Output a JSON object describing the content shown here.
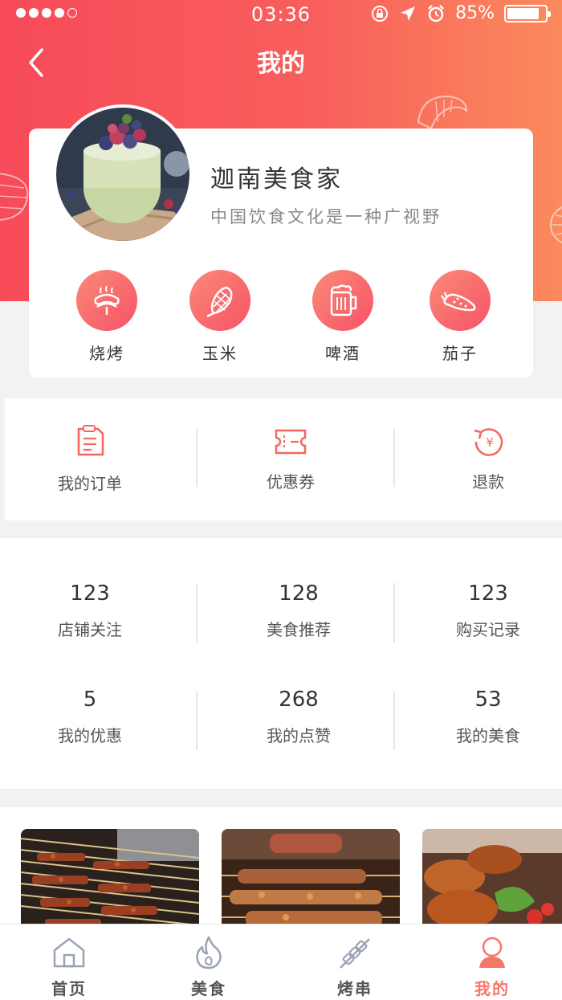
{
  "status_bar": {
    "time": "03:36",
    "battery": "85%",
    "battery_level": 0.85
  },
  "nav": {
    "title": "我的"
  },
  "profile": {
    "name": "迦南美食家",
    "description": "中国饮食文化是一种广视野"
  },
  "categories": [
    {
      "label": "烧烤",
      "icon": "sausage-icon"
    },
    {
      "label": "玉米",
      "icon": "corn-icon"
    },
    {
      "label": "啤酒",
      "icon": "beer-icon"
    },
    {
      "label": "茄子",
      "icon": "eggplant-icon"
    }
  ],
  "orders": [
    {
      "label": "我的订单",
      "icon": "order-list-icon"
    },
    {
      "label": "优惠券",
      "icon": "coupon-icon"
    },
    {
      "label": "退款",
      "icon": "refund-icon"
    }
  ],
  "stats": [
    {
      "value": "123",
      "label": "店铺关注"
    },
    {
      "value": "128",
      "label": "美食推荐"
    },
    {
      "value": "123",
      "label": "购买记录"
    },
    {
      "value": "5",
      "label": "我的优惠"
    },
    {
      "value": "268",
      "label": "我的点赞"
    },
    {
      "value": "53",
      "label": "我的美食"
    }
  ],
  "tabs": [
    {
      "label": "首页",
      "icon": "home-icon"
    },
    {
      "label": "美食",
      "icon": "flame-icon"
    },
    {
      "label": "烤串",
      "icon": "skewer-icon"
    },
    {
      "label": "我的",
      "icon": "profile-icon",
      "active": true
    }
  ],
  "colors": {
    "accent": "#f6766a",
    "gradient_start": "#f74b5a",
    "gradient_end": "#fb8a5c"
  }
}
